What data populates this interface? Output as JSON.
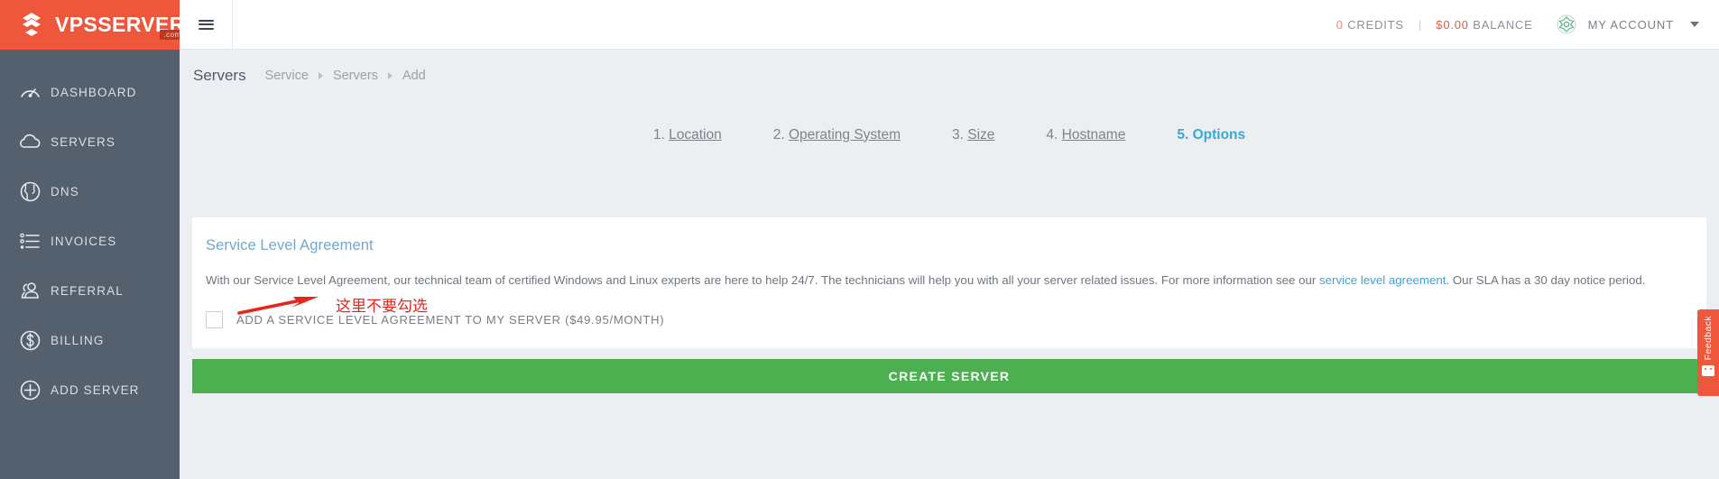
{
  "brand": {
    "name": "VPSSERVER",
    "suffix": ".com"
  },
  "topbar": {
    "menu_icon": "hamburger-icon",
    "credits_value": "0",
    "credits_label": "CREDITS",
    "separator": "|",
    "balance_value": "$0.00",
    "balance_label": "BALANCE",
    "account_icon": "flower-badge-icon",
    "account_label": "MY ACCOUNT",
    "caret_icon": "chevron-down-icon"
  },
  "sidebar": {
    "items": [
      {
        "label": "DASHBOARD",
        "icon": "gauge-icon"
      },
      {
        "label": "SERVERS",
        "icon": "cloud-icon"
      },
      {
        "label": "DNS",
        "icon": "globe-icon"
      },
      {
        "label": "INVOICES",
        "icon": "list-icon"
      },
      {
        "label": "REFERRAL",
        "icon": "users-icon"
      },
      {
        "label": "BILLING",
        "icon": "dollar-circle-icon"
      },
      {
        "label": "ADD SERVER",
        "icon": "plus-circle-icon"
      }
    ]
  },
  "breadcrumb": {
    "page_title": "Servers",
    "items": [
      "Service",
      "Servers",
      "Add"
    ]
  },
  "steps": [
    {
      "num": "1.",
      "label": "Location",
      "active": false
    },
    {
      "num": "2.",
      "label": "Operating System",
      "active": false
    },
    {
      "num": "3.",
      "label": "Size",
      "active": false
    },
    {
      "num": "4.",
      "label": "Hostname",
      "active": false
    },
    {
      "num": "5.",
      "label": "Options",
      "active": true
    }
  ],
  "panel": {
    "title": "Service Level Agreement",
    "body_part1": "With our Service Level Agreement, our technical team of certified Windows and Linux experts are here to help 24/7. The technicians will help you with all your server related issues. For more information see our ",
    "body_link": "service level agreement",
    "body_part2": ". Our SLA has a 30 day notice period.",
    "checkbox_label": "ADD A SERVICE LEVEL AGREEMENT TO MY SERVER ($49.95/MONTH)",
    "checkbox_checked": false
  },
  "annotation": {
    "text": "这里不要勾选",
    "color": "#e8241c",
    "arrow_icon": "red-arrow-right-icon"
  },
  "create_button": {
    "label": "CREATE SERVER",
    "color": "#4caf50"
  },
  "feedback": {
    "label": "Feedback",
    "icon": "feedback-face-icon",
    "color": "#ef573c"
  },
  "colors": {
    "brand_orange": "#ef573c",
    "sidebar": "#55606e",
    "content_bg": "#eceff1",
    "accent_blue": "#3ba7d6",
    "green": "#4caf50"
  }
}
